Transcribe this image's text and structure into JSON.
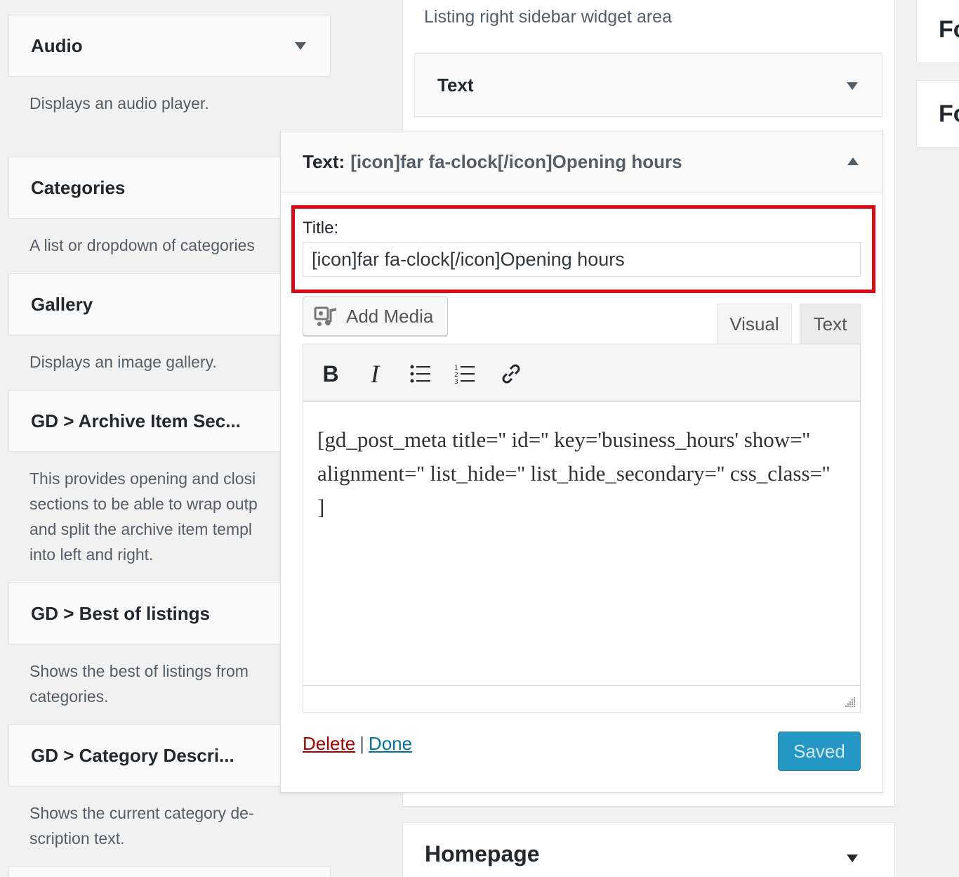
{
  "available_widgets": [
    {
      "title": "Audio",
      "description": "Displays an audio player."
    },
    {
      "title": "Categories",
      "description": "A list or dropdown of categories"
    },
    {
      "title": "Gallery",
      "description": "Displays an image gallery."
    },
    {
      "title": "GD > Archive Item Sec...",
      "description": "This provides opening and closi\nsections to be able to wrap outp\nand split the archive item templ\ninto left and right."
    },
    {
      "title": "GD > Best of listings",
      "description": "Shows the best of listings from\ncategories."
    },
    {
      "title": "GD > Category Descri...",
      "description": "Shows the current category de-\nscription text."
    }
  ],
  "sidebar": {
    "description": "Listing right sidebar widget area",
    "collapsed_widget_title": "Text",
    "open_widget": {
      "header_label": "Text:",
      "header_title": "[icon]far fa-clock[/icon]Opening hours",
      "title_label": "Title:",
      "title_value": "[icon]far fa-clock[/icon]Opening hours",
      "add_media_label": "Add Media",
      "tab_visual": "Visual",
      "tab_text": "Text",
      "toolbar": {
        "bold": "B",
        "italic": "I"
      },
      "content": "[gd_post_meta title='' id='' key='business_hours' show='' alignment='' list_hide='' list_hide_secondary='' css_class='' ]",
      "delete_label": "Delete",
      "separator": "|",
      "done_label": "Done",
      "saved_label": "Saved"
    }
  },
  "homepage": {
    "title": "Homepage"
  },
  "right_column": [
    {
      "title": "Fo"
    },
    {
      "title": "Fo"
    }
  ],
  "colors": {
    "highlight": "#e30613",
    "primary_button": "#0085ba",
    "delete_link": "#a00000",
    "done_link": "#0073aa"
  }
}
